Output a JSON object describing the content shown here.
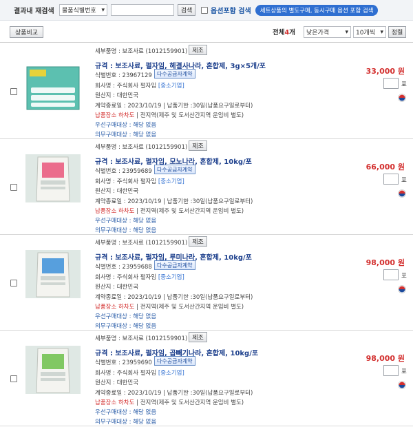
{
  "search": {
    "label": "결과내 재검색",
    "select_value": "물품식별번호",
    "button_label": "검색",
    "option_label": "옵션포함 검색",
    "notice_pill": "세트상품의 별도구매, 동시구매 옵션 포함 검색"
  },
  "toolbar": {
    "compare_label": "상품비교",
    "total_prefix": "전체",
    "total_count": "4",
    "total_suffix": "개",
    "sort_value": "낮은가격",
    "per_page_value": "10개씩",
    "sort_button": "정렬"
  },
  "items": [
    {
      "category": "세부품명 : 보조사료 (1012159901)",
      "category_button": "제조",
      "title": "규격 : 보조사료, 펄자임, 헤결사나라, 혼합제, 3g×5개/포",
      "id_label": "식별번호 : 23967129",
      "badge": "다수공급자계약",
      "maker": "회사명 : 주식회사 펄자임",
      "maker_tag": "[중소기업]",
      "origin": "원산지 : 대한민국",
      "contract": "계약종료일 : 2023/10/19 | 납품기한 :30일(납품요구일로부터)",
      "deliver_place": "납품장소 하차도",
      "deliver_rest": " | 전지역(제주 및 도서산간지역 운임비 별도)",
      "pref1": "우선구매대상 : 해당 없음",
      "pref2": "의무구매대상 : 해당 없음",
      "price": "33,000 원",
      "qty_unit": "포",
      "image_color": "#4bb6a6"
    },
    {
      "category": "세부품명 : 보조사료 (1012159901)",
      "category_button": "제조",
      "title": "규격 : 보조사료, 펄자임, 모노나라, 혼합제, 10kg/포",
      "id_label": "식별번호 : 23959689",
      "badge": "다수공급자계약",
      "maker": "회사명 : 주식회사 펄자임",
      "maker_tag": "[중소기업]",
      "origin": "원산지 : 대한민국",
      "contract": "계약종료일 : 2023/10/19 | 납품기한 :30일(납품요구일로부터)",
      "deliver_place": "납품장소 하차도",
      "deliver_rest": " | 전지역(제주 및 도서산간지역 운임비 별도)",
      "pref1": "우선구매대상 : 해당 없음",
      "pref2": "의무구매대상 : 해당 없음",
      "price": "66,000 원",
      "qty_unit": "포",
      "image_color": "#e9557a"
    },
    {
      "category": "세부품명 : 보조사료 (1012159901)",
      "category_button": "제조",
      "title": "규격 : 보조사료, 펄자임, 루미나라, 혼합제, 10kg/포",
      "id_label": "식별번호 : 23959688",
      "badge": "다수공급자계약",
      "maker": "회사명 : 주식회사 펄자임",
      "maker_tag": "[중소기업]",
      "origin": "원산지 : 대한민국",
      "contract": "계약종료일 : 2023/10/19 | 납품기한 :30일(납품요구일로부터)",
      "deliver_place": "납품장소 하차도",
      "deliver_rest": " | 전지역(제주 및 도서산간지역 운임비 별도)",
      "pref1": "우선구매대상 : 해당 없음",
      "pref2": "의무구매대상 : 해당 없음",
      "price": "98,000 원",
      "qty_unit": "포",
      "image_color": "#3b8fd9"
    },
    {
      "category": "세부품명 : 보조사료 (1012159901)",
      "category_button": "제조",
      "title": "규격 : 보조사료, 펄자임, 곱빼기나라, 혼합제, 10kg/포",
      "id_label": "식별번호 : 23959690",
      "badge": "다수공급자계약",
      "maker": "회사명 : 주식회사 펄자임",
      "maker_tag": "[중소기업]",
      "origin": "원산지 : 대한민국",
      "contract": "계약종료일 : 2023/10/19 | 납품기한 :30일(납품요구일로부터)",
      "deliver_place": "납품장소 하차도",
      "deliver_rest": " | 전지역(제주 및 도서산간지역 운임비 별도)",
      "pref1": "우선구매대상 : 해당 없음",
      "pref2": "의무구매대상 : 해당 없음",
      "price": "98,000 원",
      "qty_unit": "포",
      "image_color": "#6cbf4a"
    }
  ]
}
